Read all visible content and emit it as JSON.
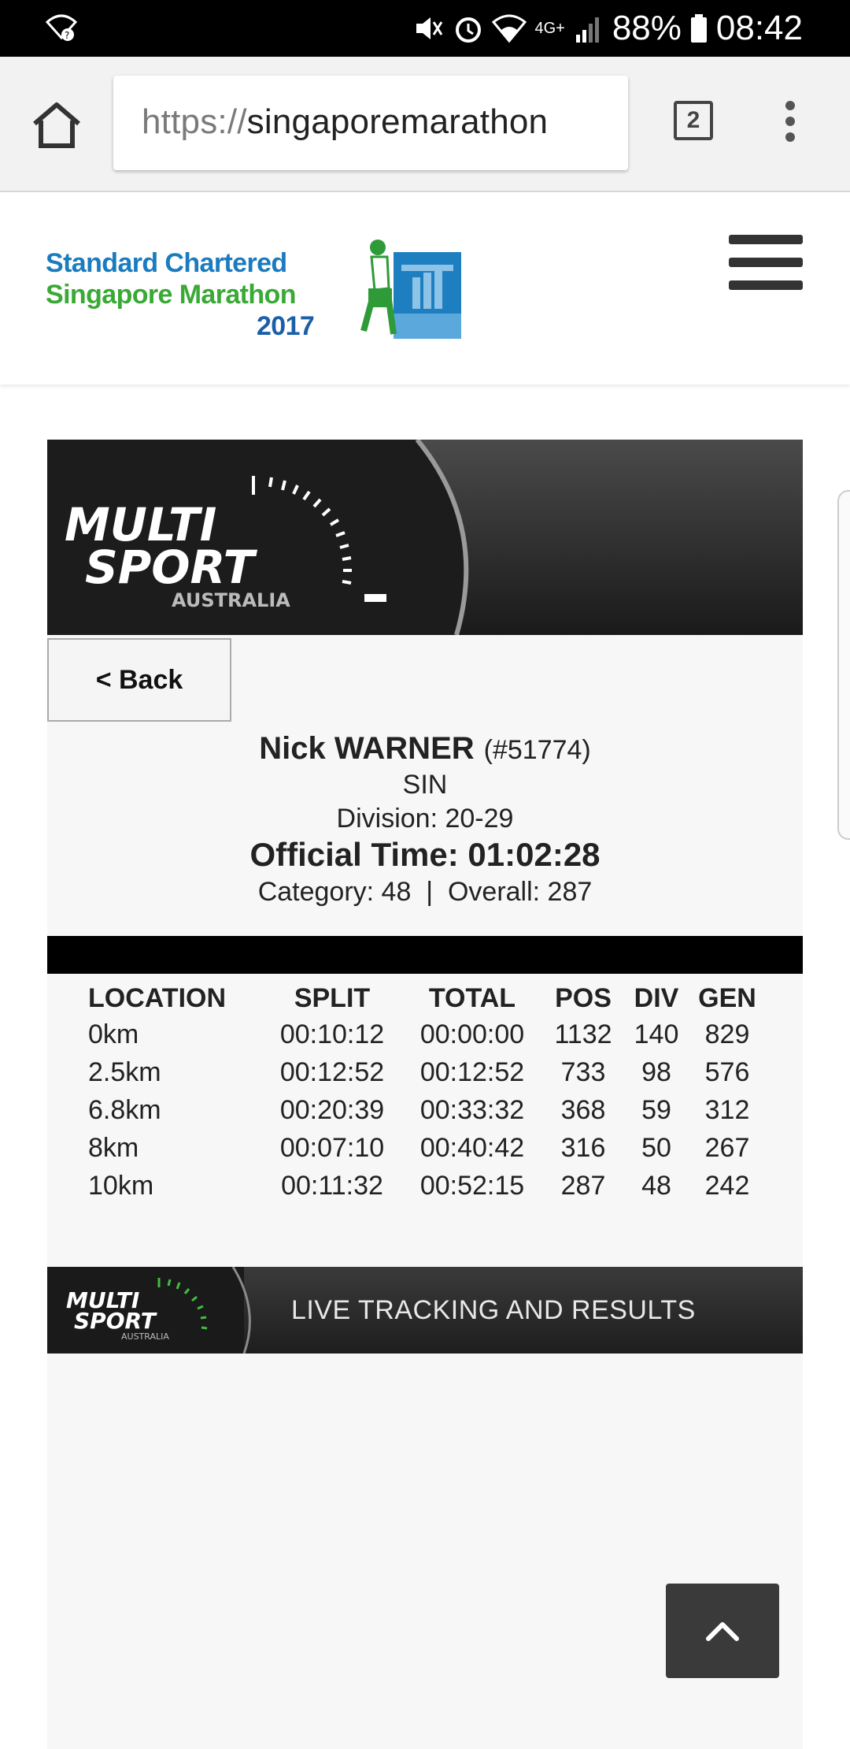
{
  "status_bar": {
    "battery_percent": "88%",
    "time": "08:42",
    "network": "4G+"
  },
  "browser": {
    "url_protocol": "https://",
    "url_host": "singaporemarathon",
    "tab_count": "2"
  },
  "site": {
    "logo_line1": "Standard Chartered",
    "logo_line2": "Singapore Marathon",
    "logo_line3": "2017"
  },
  "banner": {
    "brand_line1": "MULTI",
    "brand_line2": "SPORT",
    "brand_line3": "AUSTRALIA"
  },
  "back_label": "< Back",
  "runner": {
    "name": "Nick WARNER",
    "bib": "(#51774)",
    "country": "SIN",
    "division": "Division: 20-29",
    "official_time": "Official Time: 01:02:28",
    "category_overall": "Category: 48  |  Overall: 287"
  },
  "splits_table": {
    "headers": {
      "location": "LOCATION",
      "split": "SPLIT",
      "total": "TOTAL",
      "pos": "POS",
      "div": "DIV",
      "gen": "GEN"
    },
    "rows": [
      {
        "location": "0km",
        "split": "00:10:12",
        "total": "00:00:00",
        "pos": "1132",
        "div": "140",
        "gen": "829"
      },
      {
        "location": "2.5km",
        "split": "00:12:52",
        "total": "00:12:52",
        "pos": "733",
        "div": "98",
        "gen": "576"
      },
      {
        "location": "6.8km",
        "split": "00:20:39",
        "total": "00:33:32",
        "pos": "368",
        "div": "59",
        "gen": "312"
      },
      {
        "location": "8km",
        "split": "00:07:10",
        "total": "00:40:42",
        "pos": "316",
        "div": "50",
        "gen": "267"
      },
      {
        "location": "10km",
        "split": "00:11:32",
        "total": "00:52:15",
        "pos": "287",
        "div": "48",
        "gen": "242"
      }
    ]
  },
  "footer_banner": {
    "text": "LIVE TRACKING AND RESULTS"
  },
  "icons": {
    "home": "home-icon",
    "menu": "hamburger-icon",
    "overflow": "more-vert-icon",
    "scroll_top": "chevron-up-icon"
  },
  "colors": {
    "logo_blue": "#1a7bbf",
    "logo_green": "#3aa935",
    "banner_dark": "#1c1c1c",
    "accent_green": "#3fbf3f"
  }
}
